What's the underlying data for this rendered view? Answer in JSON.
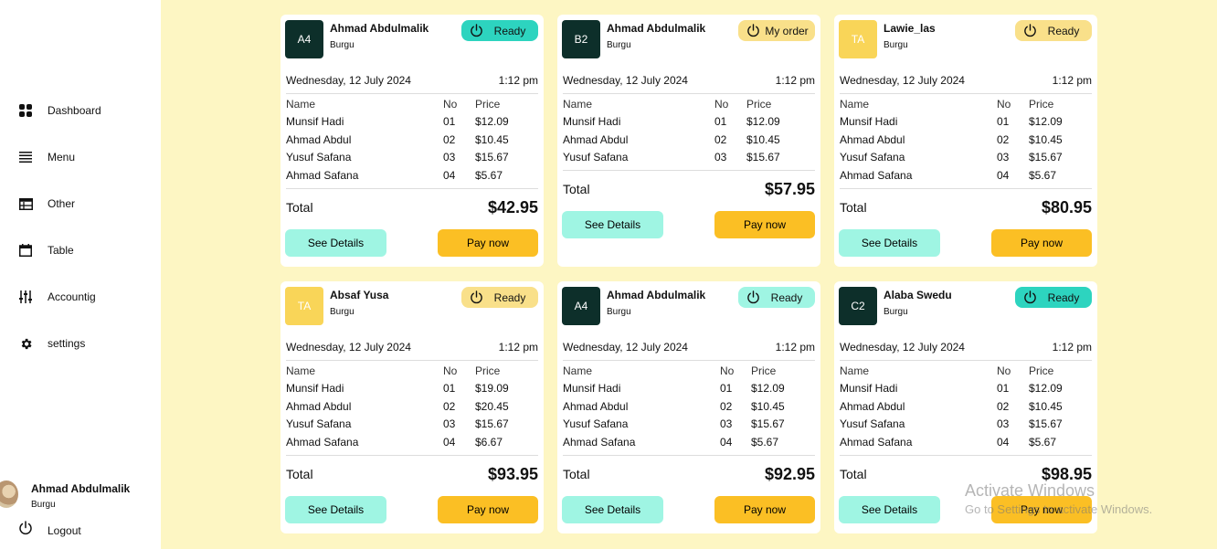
{
  "sidebar": {
    "items": [
      {
        "label": "Dashboard",
        "icon": "dashboard-icon"
      },
      {
        "label": "Menu",
        "icon": "menu-icon"
      },
      {
        "label": "Other",
        "icon": "table-list-icon"
      },
      {
        "label": "Table",
        "icon": "calendar-icon"
      },
      {
        "label": "Accountig",
        "icon": "sliders-icon"
      },
      {
        "label": "settings",
        "icon": "gear-icon"
      }
    ],
    "profile": {
      "name": "Ahmad Abdulmalik",
      "role": "Burgu"
    },
    "logout": "Logout"
  },
  "columns": {
    "name": "Name",
    "no": "No",
    "price": "Price"
  },
  "labels": {
    "total": "Total",
    "details": "See Details",
    "pay": "Pay now"
  },
  "colors": {
    "teal": "#2dd4bf",
    "mint": "#9ff5e3",
    "gold": "#fbbf24",
    "dark": "#0d2f2a",
    "background": "#fdf6c3"
  },
  "orders": [
    {
      "badge": "A4",
      "name": "Ahmad Abdulmalik",
      "sub": "Burgu",
      "status": "Ready",
      "date": "Wednesday, 12 July 2024",
      "time": "1:12 pm",
      "items": [
        [
          "Munsif Hadi",
          "01",
          "$12.09"
        ],
        [
          "Ahmad Abdul",
          "02",
          "$10.45"
        ],
        [
          "Yusuf Safana",
          "03",
          "$15.67"
        ],
        [
          "Ahmad Safana",
          "04",
          "$5.67"
        ]
      ],
      "total": "$42.95"
    },
    {
      "badge": "B2",
      "name": "Ahmad Abdulmalik",
      "sub": "Burgu",
      "status": "My order",
      "date": "Wednesday, 12 July 2024",
      "time": "1:12 pm",
      "items": [
        [
          "Munsif Hadi",
          "01",
          "$12.09"
        ],
        [
          "Ahmad Abdul",
          "02",
          "$10.45"
        ],
        [
          "Yusuf Safana",
          "03",
          "$15.67"
        ]
      ],
      "total": "$57.95"
    },
    {
      "badge": "TA",
      "name": "Lawie_las",
      "sub": "Burgu",
      "status": "Ready",
      "date": "Wednesday, 12 July 2024",
      "time": "1:12 pm",
      "items": [
        [
          "Munsif Hadi",
          "01",
          "$12.09"
        ],
        [
          "Ahmad Abdul",
          "02",
          "$10.45"
        ],
        [
          "Yusuf Safana",
          "03",
          "$15.67"
        ],
        [
          "Ahmad Safana",
          "04",
          "$5.67"
        ]
      ],
      "total": "$80.95"
    },
    {
      "badge": "TA",
      "name": "Absaf Yusa",
      "sub": "Burgu",
      "status": "Ready",
      "date": "Wednesday, 12 July 2024",
      "time": "1:12 pm",
      "items": [
        [
          "Munsif Hadi",
          "01",
          "$19.09"
        ],
        [
          "Ahmad Abdul",
          "02",
          "$20.45"
        ],
        [
          "Yusuf Safana",
          "03",
          "$15.67"
        ],
        [
          "Ahmad Safana",
          "04",
          "$6.67"
        ]
      ],
      "total": "$93.95"
    },
    {
      "badge": "A4",
      "name": "Ahmad Abdulmalik",
      "sub": "Burgu",
      "status": "Ready",
      "date": "Wednesday, 12 July 2024",
      "time": "1:12 pm",
      "items": [
        [
          "Munsif Hadi",
          "01",
          "$12.09"
        ],
        [
          "Ahmad Abdul",
          "02",
          "$10.45"
        ],
        [
          "Yusuf Safana",
          "03",
          "$15.67"
        ],
        [
          "Ahmad Safana",
          "04",
          "$5.67"
        ]
      ],
      "total": "$92.95"
    },
    {
      "badge": "C2",
      "name": "Alaba Swedu",
      "sub": "Burgu",
      "status": "Ready",
      "date": "Wednesday, 12 July 2024",
      "time": "1:12 pm",
      "items": [
        [
          "Munsif Hadi",
          "01",
          "$12.09"
        ],
        [
          "Ahmad Abdul",
          "02",
          "$10.45"
        ],
        [
          "Yusuf Safana",
          "03",
          "$15.67"
        ],
        [
          "Ahmad Safana",
          "04",
          "$5.67"
        ]
      ],
      "total": "$98.95"
    }
  ],
  "watermark": {
    "title": "Activate Windows",
    "subtitle": "Go to Settings to activate Windows."
  }
}
